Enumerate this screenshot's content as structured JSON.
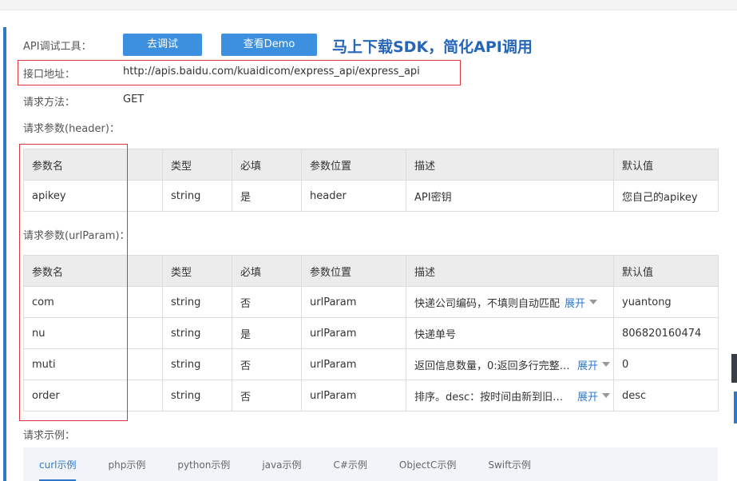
{
  "debug": {
    "label": "API调试工具：",
    "debug_button": "去调试",
    "demo_button": "查看Demo",
    "promo": "马上下载SDK，简化API调用"
  },
  "endpoint": {
    "label": "接口地址：",
    "url": "http://apis.baidu.com/kuaidicom/express_api/express_api"
  },
  "method": {
    "label": "请求方法：",
    "value": "GET"
  },
  "header_params": {
    "title": "请求参数(header)：",
    "columns": [
      "参数名",
      "类型",
      "必填",
      "参数位置",
      "描述",
      "默认值"
    ],
    "rows": [
      {
        "name": "apikey",
        "type": "string",
        "required": "是",
        "position": "header",
        "desc": "API密钥",
        "default": "您自己的apikey"
      }
    ]
  },
  "url_params": {
    "title": "请求参数(urlParam)：",
    "columns": [
      "参数名",
      "类型",
      "必填",
      "参数位置",
      "描述",
      "默认值"
    ],
    "expand_label": "展开",
    "rows": [
      {
        "name": "com",
        "type": "string",
        "required": "否",
        "position": "urlParam",
        "desc": "快递公司编码，不填则自动匹配",
        "default": "yuantong"
      },
      {
        "name": "nu",
        "type": "string",
        "required": "是",
        "position": "urlParam",
        "desc": "快递单号",
        "default": "806820160474"
      },
      {
        "name": "muti",
        "type": "string",
        "required": "否",
        "position": "urlParam",
        "desc": "返回信息数量，0:返回多行完整的...",
        "default": "0"
      },
      {
        "name": "order",
        "type": "string",
        "required": "否",
        "position": "urlParam",
        "desc": "排序。desc：按时间由新到旧排...",
        "default": "desc"
      }
    ]
  },
  "examples": {
    "title": "请求示例：",
    "tabs": [
      "curl示例",
      "php示例",
      "python示例",
      "java示例",
      "C#示例",
      "ObjectC示例",
      "Swift示例"
    ]
  }
}
